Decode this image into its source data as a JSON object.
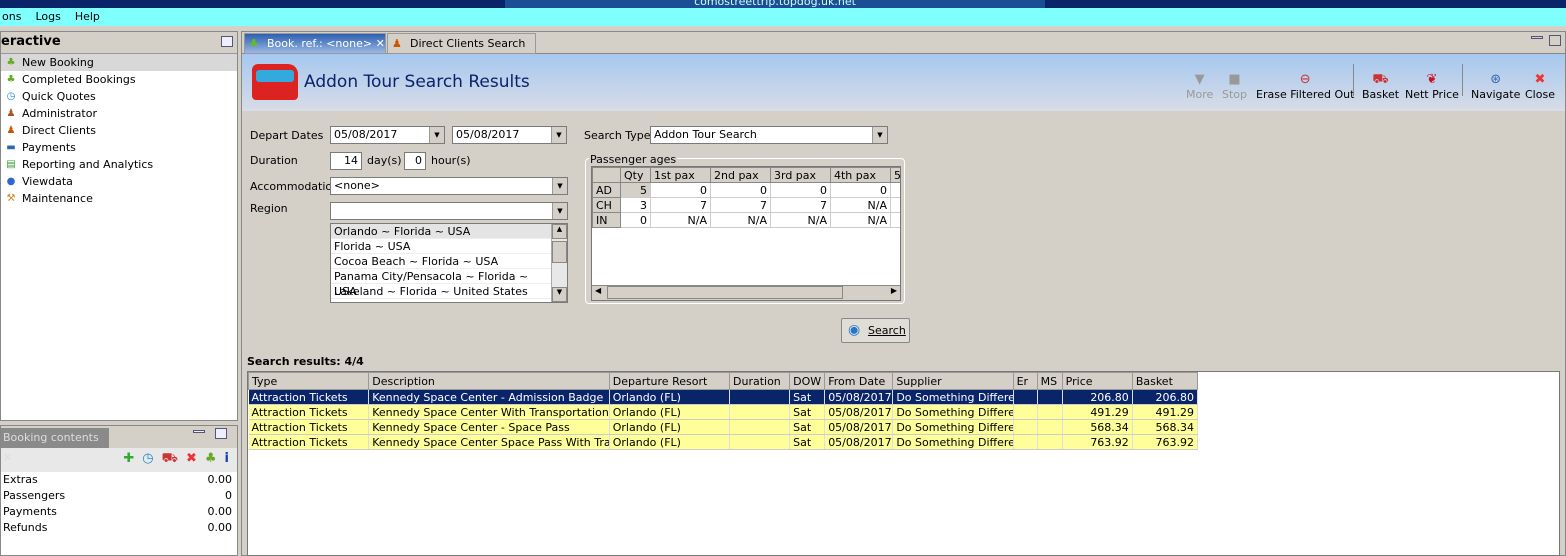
{
  "window": {
    "remote_title": "comostreettrip.topdog.uk.net"
  },
  "menu": [
    "ons",
    "Logs",
    "Help"
  ],
  "left_panel": {
    "title": "eractive",
    "items": [
      {
        "label": "New Booking",
        "icon": "palm-tree-icon"
      },
      {
        "label": "Completed Bookings",
        "icon": "palm-money-icon"
      },
      {
        "label": "Quick Quotes",
        "icon": "clock-icon"
      },
      {
        "label": "Administrator",
        "icon": "person-icon"
      },
      {
        "label": "Direct Clients",
        "icon": "client-icon"
      },
      {
        "label": "Payments",
        "icon": "payment-icon"
      },
      {
        "label": "Reporting and Analytics",
        "icon": "report-icon"
      },
      {
        "label": "Viewdata",
        "icon": "globe-icon"
      },
      {
        "label": "Maintenance",
        "icon": "maintenance-icon"
      }
    ]
  },
  "booking_contents": {
    "tab": "Booking contents",
    "rows": [
      {
        "label": "Extras",
        "value": "0.00"
      },
      {
        "label": "Passengers",
        "value": "0"
      },
      {
        "label": "Payments",
        "value": "0.00"
      },
      {
        "label": "Refunds",
        "value": "0.00"
      }
    ]
  },
  "tabs": [
    {
      "label": "Book. ref.: <none>"
    },
    {
      "label": "Direct Clients Search"
    }
  ],
  "header": {
    "title": "Addon Tour Search Results"
  },
  "toolbar": {
    "more": "More",
    "stop": "Stop",
    "erase": "Erase Filtered Out",
    "basket": "Basket",
    "nett": "Nett Price",
    "navigate": "Navigate",
    "close": "Close"
  },
  "form": {
    "depart_label": "Depart Dates",
    "depart_from": "05/08/2017",
    "depart_to": "05/08/2017",
    "duration_label": "Duration",
    "days": "14",
    "days_unit": "day(s)",
    "hours": "0",
    "hours_unit": "hour(s)",
    "accommodation_label": "Accommodation",
    "accommodation": "<none>",
    "region_label": "Region",
    "region": "",
    "regions": [
      "Orlando ~ Florida ~ USA",
      "Florida ~ USA",
      "Cocoa Beach ~ Florida ~ USA",
      "Panama City/Pensacola ~  Florida  ~ USA",
      "Lakeland ~ Florida ~ United States"
    ],
    "search_type_label": "Search Type",
    "search_type": "Addon Tour Search",
    "search_button": "Search"
  },
  "passengers": {
    "legend": "Passenger ages",
    "headers": [
      "",
      "Qty",
      "1st pax",
      "2nd pax",
      "3rd pax",
      "4th pax",
      "5"
    ],
    "rows": [
      [
        "AD",
        "5",
        "0",
        "0",
        "0",
        "0",
        ""
      ],
      [
        "CH",
        "3",
        "7",
        "7",
        "7",
        "N/A",
        ""
      ],
      [
        "IN",
        "0",
        "N/A",
        "N/A",
        "N/A",
        "N/A",
        ""
      ]
    ]
  },
  "results": {
    "label": "Search results: 4/4",
    "headers": [
      "Type",
      "Description",
      "Departure Resort",
      "Duration",
      "DOW",
      "From Date",
      "Supplier",
      "Er",
      "MS",
      "Price",
      "Basket"
    ],
    "rows": [
      [
        "Attraction Tickets",
        "Kennedy Space Center - Admission Badge",
        "Orlando (FL)",
        "",
        "Sat",
        "05/08/2017",
        "Do Something Different",
        "",
        "",
        "206.80",
        "206.80"
      ],
      [
        "Attraction Tickets",
        "Kennedy Space Center With Transportation",
        "Orlando (FL)",
        "",
        "Sat",
        "05/08/2017",
        "Do Something Different",
        "",
        "",
        "491.29",
        "491.29"
      ],
      [
        "Attraction Tickets",
        "Kennedy Space Center - Space Pass",
        "Orlando (FL)",
        "",
        "Sat",
        "05/08/2017",
        "Do Something Different",
        "",
        "",
        "568.34",
        "568.34"
      ],
      [
        "Attraction Tickets",
        "Kennedy Space Center Space Pass With Trans...",
        "Orlando (FL)",
        "",
        "Sat",
        "05/08/2017",
        "Do Something Different",
        "",
        "",
        "763.92",
        "763.92"
      ]
    ]
  }
}
